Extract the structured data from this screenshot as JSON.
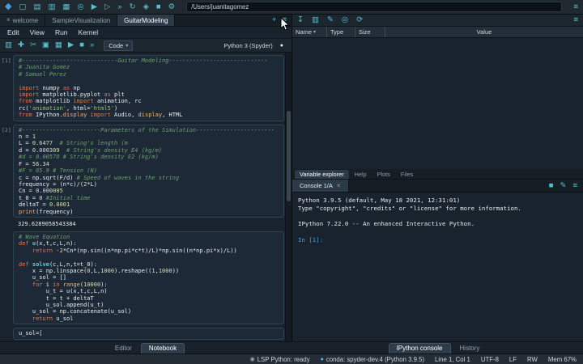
{
  "main_toolbar": {
    "icons": [
      {
        "name": "app-logo-icon",
        "glyph": "◆"
      },
      {
        "name": "new-file-icon",
        "glyph": "▢"
      },
      {
        "name": "open-file-icon",
        "glyph": "▤"
      },
      {
        "name": "save-file-icon",
        "glyph": "▥"
      },
      {
        "name": "save-all-icon",
        "glyph": "▦"
      },
      {
        "name": "find-icon",
        "glyph": "◎"
      },
      {
        "name": "run-file-icon",
        "glyph": "▶"
      },
      {
        "name": "run-cell-icon",
        "glyph": "▷"
      },
      {
        "name": "run-selection-icon",
        "glyph": "»"
      },
      {
        "name": "rerun-icon",
        "glyph": "↻"
      },
      {
        "name": "debug-icon",
        "glyph": "◈"
      },
      {
        "name": "stop-icon",
        "glyph": "■"
      },
      {
        "name": "preferences-icon",
        "glyph": "⚙"
      }
    ],
    "path_value": "/Users/juanitagomez",
    "options_icon": {
      "name": "main-menu-icon",
      "glyph": "≡"
    }
  },
  "editor": {
    "tabs": [
      {
        "label": "welcome",
        "active": false,
        "closable": true
      },
      {
        "label": "SampleVisualization",
        "active": false,
        "closable": false
      },
      {
        "label": "GuitarModeling",
        "active": true,
        "closable": false
      }
    ],
    "tabbar_icons": [
      {
        "name": "new-tab-icon",
        "glyph": "+"
      },
      {
        "name": "browse-tabs-icon",
        "glyph": "≡"
      }
    ],
    "menu_items": [
      "Edit",
      "View",
      "Run",
      "Kernel"
    ],
    "toolbar_icons": [
      {
        "name": "save-notebook-icon",
        "glyph": "▥"
      },
      {
        "name": "add-cell-icon",
        "glyph": "✚"
      },
      {
        "name": "cut-cell-icon",
        "glyph": "✂"
      },
      {
        "name": "copy-cell-icon",
        "glyph": "▣"
      },
      {
        "name": "paste-cell-icon",
        "glyph": "▦"
      },
      {
        "name": "run-cell-icon",
        "glyph": "▶"
      },
      {
        "name": "interrupt-kernel-icon",
        "glyph": "■"
      },
      {
        "name": "restart-run-all-icon",
        "glyph": "»"
      }
    ],
    "cell_type_value": "Code",
    "dropdown_icon": "▾",
    "kernel_label": "Python 3 (Spyder)",
    "kernel_status_icon": "●",
    "cells": [
      {
        "label": "[1]",
        "lines": [
          "#----------------------------Guitar Modeling-----------------------------",
          "# Juanita Gomez",
          "# Samuel Perez",
          "",
          "import numpy as np",
          "import matplotlib.pyplot as plt",
          "from matplotlib import animation, rc",
          "rc('animation', html='html5')",
          "from IPython.display import Audio, display, HTML"
        ]
      },
      {
        "label": "[2]",
        "lines": [
          "#-----------------------Parameters of the Simulation-----------------------",
          "n = 1",
          "L = 0.6477  # String's length (m",
          "d = 0.000309  # String's density E4 (kg/m)",
          "#d = 0.00578 # String's density E2 (kg/m)",
          "F = 56.34",
          "#F = 65.9 # Tension (N)",
          "c = np.sqrt(F/d) # Speed of waves in the string",
          "frequency = (n*c)/(2*L)",
          "Cn = 0.000005",
          "t_0 = 0 #Initial time",
          "deltaT = 0.0001",
          "print(frequency)"
        ],
        "output": "329.6289058543384"
      },
      {
        "label": "",
        "lines": [
          "# Wave Equation",
          "def u(x,t,c,L,n):",
          "    return -2*Cn*(np.sin((n*np.pi*c*t)/L)*np.sin((n*np.pi*x)/L))",
          "",
          "def solve(c,L,n,t=t_0):",
          "    x = np.linspace(0,L,1000).reshape((1,1000))",
          "    u_sol = []",
          "    for i in range(10000):",
          "        u_t = u(x,t,c,L,n)",
          "        t = t + deltaT",
          "        u_sol.append(u_t)",
          "    u_sol = np.concatenate(u_sol)",
          "    return u_sol"
        ]
      },
      {
        "label": "",
        "lines": [
          "u_sol=["
        ]
      }
    ],
    "bottom_tabs": [
      {
        "label": "Editor",
        "active": false
      },
      {
        "label": "Notebook",
        "active": true
      }
    ]
  },
  "variable_explorer": {
    "toolbar_icons": [
      {
        "name": "import-data-icon",
        "glyph": "↧"
      },
      {
        "name": "save-data-icon",
        "glyph": "▥"
      },
      {
        "name": "edit-icon",
        "glyph": "✎"
      },
      {
        "name": "search-icon",
        "glyph": "◎"
      },
      {
        "name": "refresh-icon",
        "glyph": "⟳"
      }
    ],
    "options_icon": {
      "name": "pane-options-icon",
      "glyph": "≡"
    },
    "columns": [
      "Name",
      "Type",
      "Size",
      "Value"
    ],
    "sort_indicator": "▾",
    "rows": [],
    "tabs": [
      {
        "label": "Variable explorer",
        "active": true
      },
      {
        "label": "Help",
        "active": false
      },
      {
        "label": "Plots",
        "active": false
      },
      {
        "label": "Files",
        "active": false
      }
    ]
  },
  "console": {
    "tab_label": "Console 1/A",
    "tab_close_icon": "×",
    "header_icons": [
      {
        "name": "stop-console-icon",
        "glyph": "■"
      },
      {
        "name": "edit-console-icon",
        "glyph": "✎"
      },
      {
        "name": "console-options-icon",
        "glyph": "≡"
      }
    ],
    "lines": [
      {
        "type": "normal",
        "text": "Python 3.9.5 (default, May 18 2021, 12:31:01)"
      },
      {
        "type": "normal",
        "text": "Type \"copyright\", \"credits\" or \"license\" for more information."
      },
      {
        "type": "normal",
        "text": ""
      },
      {
        "type": "normal",
        "text": "IPython 7.22.0 -- An enhanced Interactive Python."
      },
      {
        "type": "normal",
        "text": ""
      },
      {
        "type": "prompt",
        "text": "In [1]:"
      }
    ],
    "bottom_tabs": [
      {
        "label": "IPython console",
        "active": true
      },
      {
        "label": "History",
        "active": false
      }
    ]
  },
  "status_bar": {
    "items": [
      {
        "name": "lsp-status",
        "icon": "◉",
        "icon_color": "#9aa7b2",
        "text": "LSP Python: ready"
      },
      {
        "name": "conda-status",
        "icon": "●",
        "icon_color": "#53b9e8",
        "text": "conda: spyder-dev.4 (Python 3.9.5)"
      },
      {
        "name": "cursor-position",
        "icon": "",
        "text": "Line 1, Col 1"
      },
      {
        "name": "encoding",
        "icon": "",
        "text": "UTF-8"
      },
      {
        "name": "line-ending",
        "icon": "",
        "text": "LF"
      },
      {
        "name": "permissions",
        "icon": "",
        "text": "RW"
      },
      {
        "name": "memory-usage",
        "icon": "",
        "text": "Mem 67%"
      }
    ]
  }
}
